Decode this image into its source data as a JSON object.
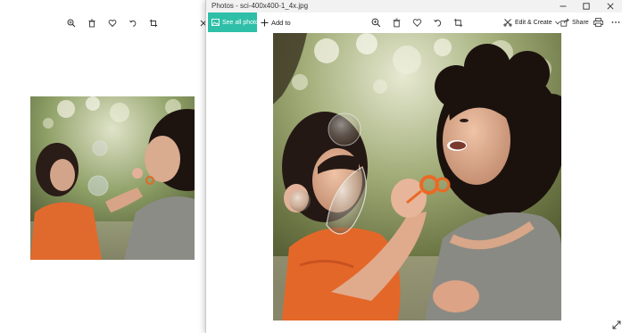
{
  "window": {
    "title": "Photos - sci-400x400-1_4x.jpg"
  },
  "command_bar": {
    "see_all_label": "See all photos",
    "add_to_label": "Add to",
    "edit_create_label": "Edit & Create",
    "share_label": "Share"
  },
  "icons": {
    "zoom": "zoom-icon",
    "delete": "trash-icon",
    "favorite": "heart-icon",
    "rotate": "rotate-icon",
    "crop": "crop-icon",
    "print": "printer-icon",
    "more": "more-icon",
    "expand": "expand-icon"
  },
  "colors": {
    "accent": "#2fbfa8",
    "titlebar": "#f2f2f2",
    "background": "#ffffff"
  },
  "photo": {
    "description_hidden": ""
  }
}
